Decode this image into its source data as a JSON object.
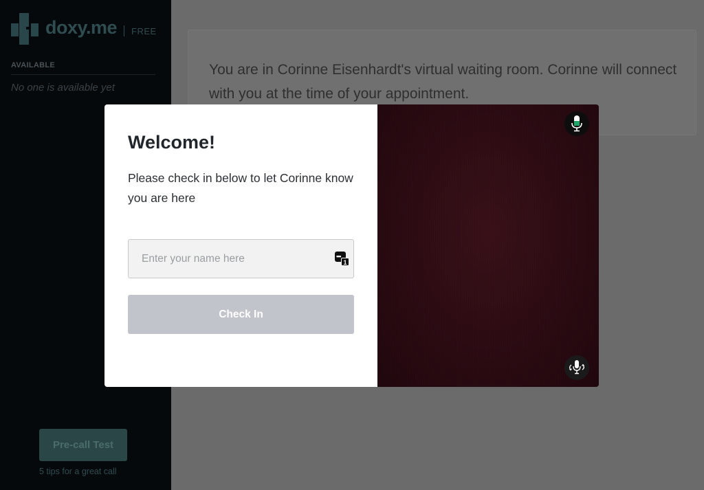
{
  "sidebar": {
    "logo_text": "doxy.me",
    "plan_label": "FREE",
    "available_heading": "AVAILABLE",
    "available_empty": "No one is available yet",
    "precall_label": "Pre-call Test",
    "tips_link": "5 tips for a great call"
  },
  "main": {
    "waiting_message": "You are in Corinne Eisenhardt's virtual waiting room. Corinne will connect with you at the time of your appointment."
  },
  "modal": {
    "title": "Welcome!",
    "description": "Please check in below to let Corinne know you are here",
    "name_input": {
      "value": "",
      "placeholder": "Enter your name here"
    },
    "input_icon_badge": "1",
    "checkin_label": "Check In"
  },
  "icons": {
    "mic": "microphone-icon",
    "switch": "switch-microphone-icon",
    "autofill": "autofill-icon"
  },
  "colors": {
    "sidebar_bg": "#06090c",
    "overlay_bg": "#6b6b6b",
    "checkin_disabled": "#c1c4cb",
    "precall_bg": "#2b4646",
    "video_bg": "#2b0b12",
    "mic_level": "#1fa56a"
  }
}
